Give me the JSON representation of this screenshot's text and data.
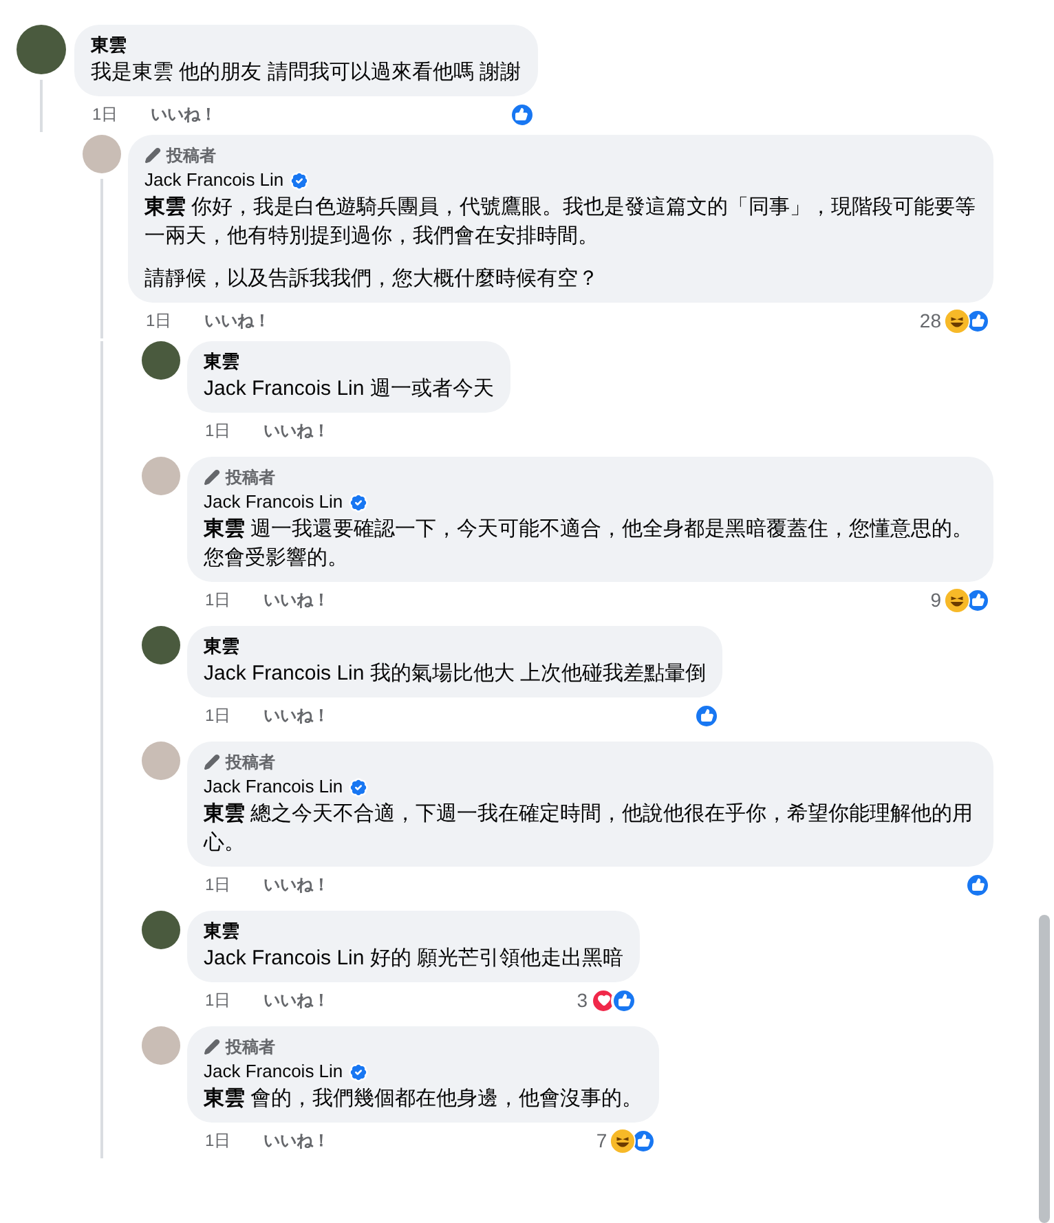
{
  "comments": [
    {
      "author": "東雲",
      "verified": false,
      "paragraphs": [
        "我是東雲 他的朋友 請問我可以過來看他嗎 謝謝"
      ],
      "time": "1日",
      "like": "いいね！",
      "reactions": [
        {
          "kind": "like"
        }
      ],
      "replies": [
        {
          "author": "Jack Francois Lin",
          "badge": "投稿者",
          "verified": true,
          "paragraphs": [
            "**東雲** 你好，我是白色遊騎兵團員，代號鷹眼。我也是發這篇文的「同事」，現階段可能要等一兩天，他有特別提到過你，我們會在安排時間。",
            "請靜候，以及告訴我我們，您大概什麼時候有空？"
          ],
          "time": "1日",
          "like": "いいね！",
          "reaction_count": "28",
          "reactions": [
            {
              "kind": "haha"
            },
            {
              "kind": "like"
            }
          ],
          "replies": [
            {
              "author": "東雲",
              "verified": false,
              "paragraphs": [
                "Jack Francois Lin 週一或者今天"
              ],
              "time": "1日",
              "like": "いいね！"
            },
            {
              "author": "Jack Francois Lin",
              "badge": "投稿者",
              "verified": true,
              "paragraphs": [
                "**東雲** 週一我還要確認一下，今天可能不適合，他全身都是黑暗覆蓋住，您懂意思的。您會受影響的。"
              ],
              "time": "1日",
              "like": "いいね！",
              "reaction_count": "9",
              "reactions": [
                {
                  "kind": "haha"
                },
                {
                  "kind": "like"
                }
              ]
            },
            {
              "author": "東雲",
              "verified": false,
              "paragraphs": [
                "Jack Francois Lin 我的氣場比他大 上次他碰我差點暈倒"
              ],
              "time": "1日",
              "like": "いいね！",
              "reactions": [
                {
                  "kind": "like"
                }
              ]
            },
            {
              "author": "Jack Francois Lin",
              "badge": "投稿者",
              "verified": true,
              "paragraphs": [
                "**東雲** 總之今天不合適，下週一我在確定時間，他說他很在乎你，希望你能理解他的用心。"
              ],
              "time": "1日",
              "like": "いいね！",
              "reactions": [
                {
                  "kind": "like"
                }
              ]
            },
            {
              "author": "東雲",
              "verified": false,
              "paragraphs": [
                "Jack Francois Lin 好的 願光芒引領他走出黑暗"
              ],
              "time": "1日",
              "like": "いいね！",
              "reaction_count": "3",
              "reactions": [
                {
                  "kind": "love"
                },
                {
                  "kind": "like"
                }
              ]
            },
            {
              "author": "Jack Francois Lin",
              "badge": "投稿者",
              "verified": true,
              "paragraphs": [
                "**東雲** 會的，我們幾個都在他身邊，他會沒事的。"
              ],
              "time": "1日",
              "like": "いいね！",
              "reaction_count": "7",
              "reactions": [
                {
                  "kind": "haha"
                },
                {
                  "kind": "like"
                }
              ]
            }
          ]
        }
      ]
    }
  ]
}
